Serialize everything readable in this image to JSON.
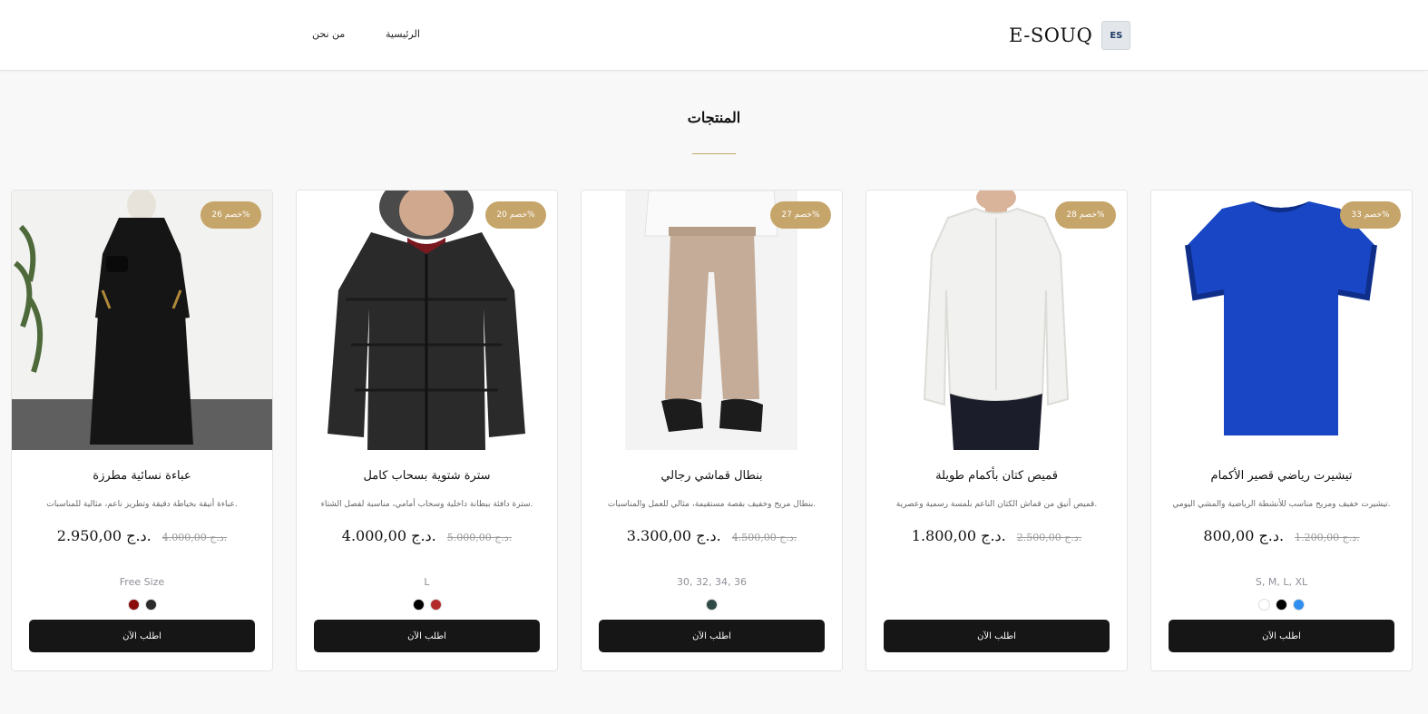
{
  "header": {
    "logo_text": "E-SOUQ",
    "logo_icon": "ES",
    "nav": {
      "home": "الرئيسية",
      "about": "من نحن"
    }
  },
  "section": {
    "title": "المنتجات"
  },
  "products": [
    {
      "name": "تيشيرت رياضي قصير الأكمام",
      "description": "تيشيرت خفيف ومريح مناسب للأنشطة الرياضية والمشي اليومي.",
      "price": "800,00 د.ج.",
      "old_price": "1.200,00 د.ج.",
      "badge": "خصم 33%",
      "sizes": "S, M, L, XL",
      "colors": [
        "#ffffff",
        "#000000",
        "#2f8fef"
      ],
      "image": "tshirt-image",
      "button": "اطلب الآن"
    },
    {
      "name": "قميص كتان بأكمام طويلة",
      "description": "قميص أنيق من قماش الكتان الناعم بلمسة رسمية وعصرية.",
      "price": "1.800,00 د.ج.",
      "old_price": "2.500,00 د.ج.",
      "badge": "خصم 28%",
      "sizes": "",
      "colors": [],
      "image": "shirt-image",
      "button": "اطلب الآن"
    },
    {
      "name": "بنطال قماشي رجالي",
      "description": "بنطال مريح وخفيف بقصة مستقيمة، مثالي للعمل والمناسبات.",
      "price": "3.300,00 د.ج.",
      "old_price": "4.500,00 د.ج.",
      "badge": "خصم 27%",
      "sizes": "30, 32, 34, 36",
      "colors": [
        "#2f4a45"
      ],
      "image": "trousers-image",
      "button": "اطلب الآن"
    },
    {
      "name": "سترة شتوية بسحاب كامل",
      "description": "سترة دافئة ببطانة داخلية وسحاب أمامي، مناسبة لفصل الشتاء.",
      "price": "4.000,00 د.ج.",
      "old_price": "5.000,00 د.ج.",
      "badge": "خصم 20%",
      "sizes": "L",
      "colors": [
        "#000000",
        "#b22a2a"
      ],
      "image": "jacket-image",
      "button": "اطلب الآن"
    },
    {
      "name": "عباءة نسائية مطرزة",
      "description": "عباءة أنيقة بخياطة دقيقة وتطريز ناعم، مثالية للمناسبات.",
      "price": "2.950,00 د.ج.",
      "old_price": "4.000,00 د.ج.",
      "badge": "خصم 26%",
      "sizes": "Free Size",
      "colors": [
        "#8b0a0a",
        "#2b2b2b"
      ],
      "image": "abaya-image",
      "button": "اطلب الآن"
    }
  ]
}
